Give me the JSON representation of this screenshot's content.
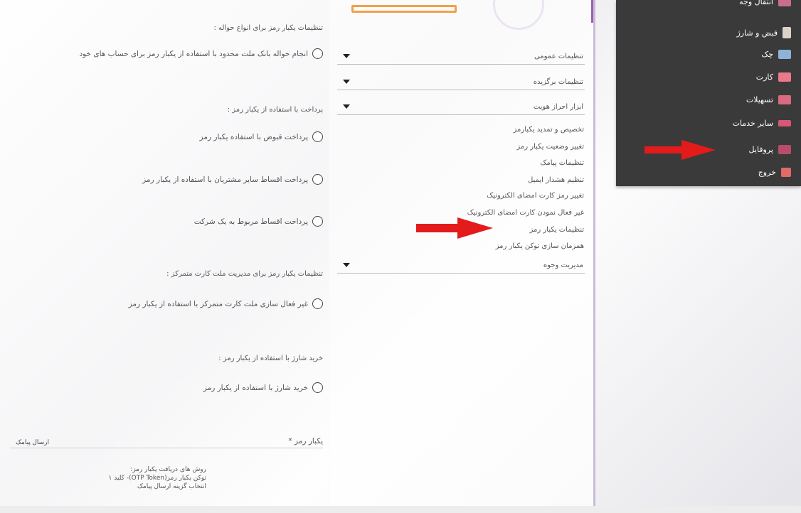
{
  "left": {
    "transfer_title": "تنظیمات یکبار رمز برای انواع حواله :",
    "transfer_opt": "انجام حواله بانک ملت محدود با استفاده از یکبار رمز برای حساب های خود",
    "payment_title": "پرداخت با استفاده از یکبار رمز :",
    "payment_opt1": "پرداخت قبوض با استفاده یکبار رمز",
    "payment_opt2": "پرداخت اقساط سایر مشتریان با استفاده از یکبار رمز",
    "payment_opt3": "پرداخت اقساط مربوط به یک شرکت",
    "card_title": "تنظیمات یکبار رمز برای مدیریت ملت کارت متمرکز :",
    "card_opt": "غیر فعال سازی ملت کارت متمرکز با استفاده از یکبار رمز",
    "charge_title": "خرید شارژ با استفاده از یکبار رمز :",
    "charge_opt": "خرید شارژ با استفاده از یکبار رمز",
    "otp_label": "یکبار رمز *",
    "sms_button": "ارسال پیامک",
    "help_1": "روش های دریافت یکبار رمز:",
    "help_2": "توکن یکبار رمز(OTP Token)- کلید ۱",
    "help_3": "انتخاب گزینه ارسال پیامک"
  },
  "mid": {
    "accordion": [
      "تنظیمات عمومی",
      "تنظیمات برگزیده",
      "ابزار احراز هویت",
      "مدیریت وجوه"
    ],
    "sub_items": [
      "تخصیص و تمدید یکبارمز",
      "تغییر وضعیت یکبار رمز",
      "تنظیمات پیامک",
      "تنظیم هشدار ایمیل",
      "تغییر رمز کارت امضای الکترونیک",
      "غیر فعال نمودن کارت امضای الکترونیک",
      "تنظیمات یکبار رمز",
      "همزمان سازی توکن یکبار رمز"
    ]
  },
  "right_menu": {
    "items": [
      "انتقال وجه",
      "قبض و شارژ",
      "چک",
      "کارت",
      "تسهیلات",
      "سایر خدمات",
      "پروفایل",
      "خروج"
    ]
  },
  "colors": {
    "arrow": "#e31b1b",
    "menu_bg": "#3a3a3a",
    "orange": "#f1a04a"
  }
}
